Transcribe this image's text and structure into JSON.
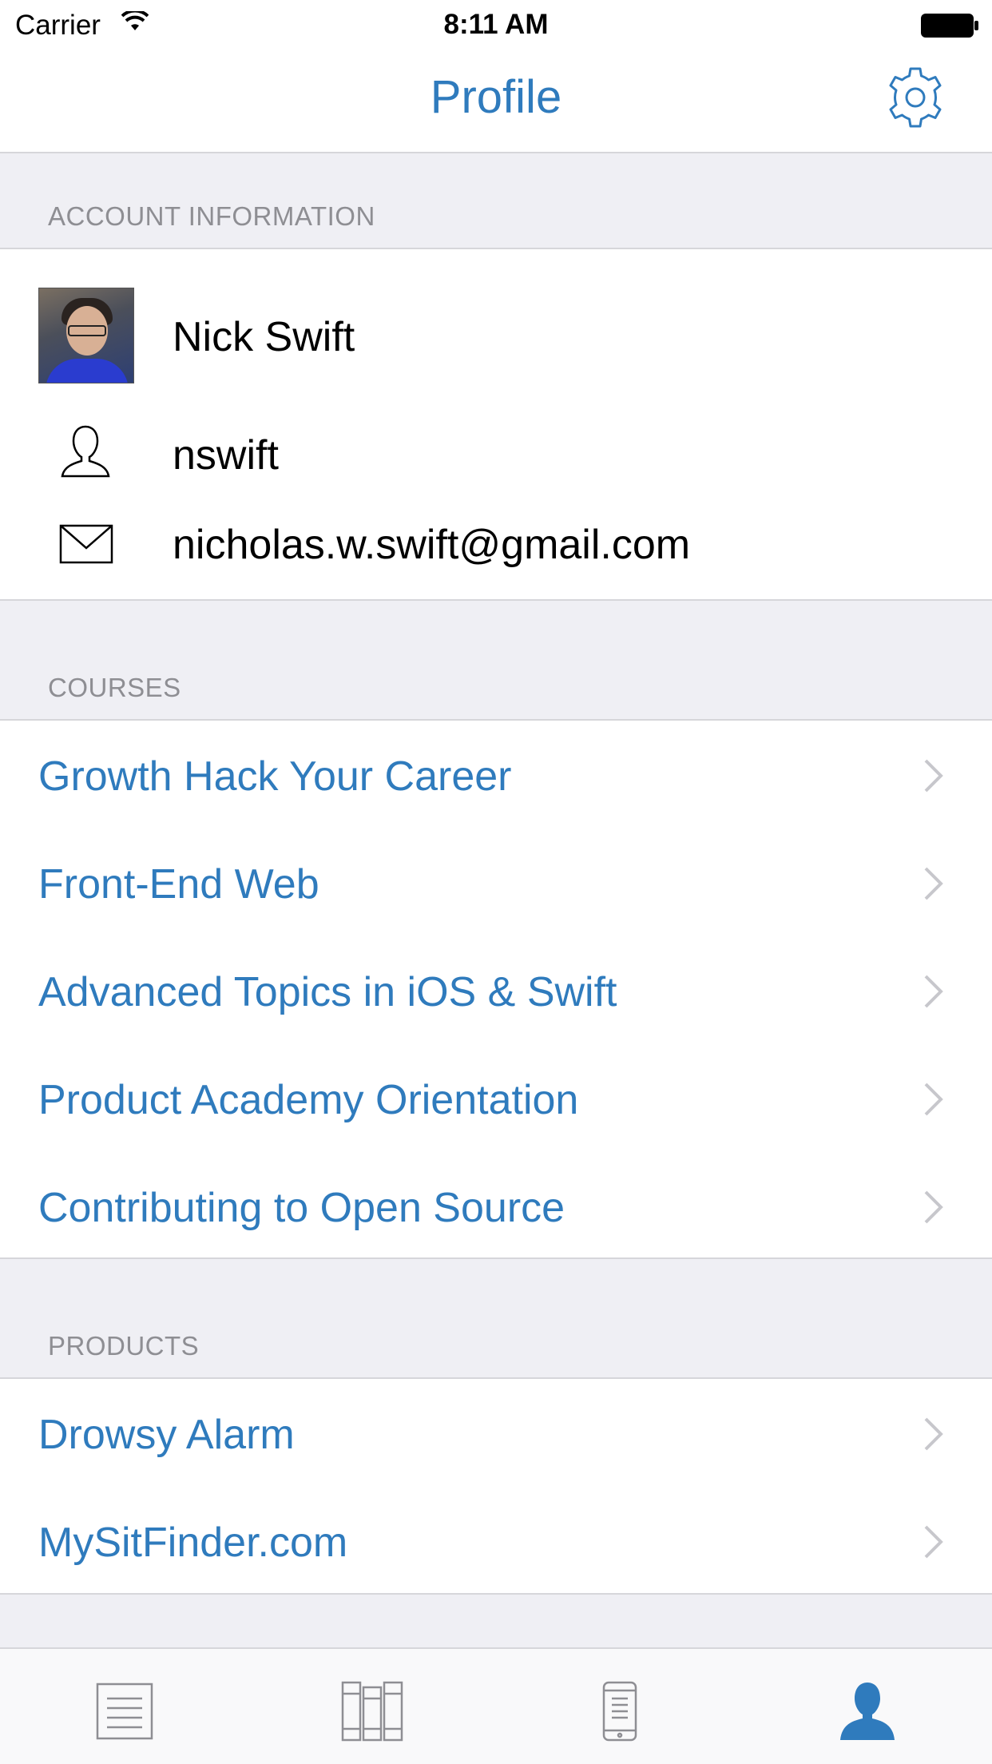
{
  "status_bar": {
    "carrier": "Carrier",
    "time": "8:11 AM"
  },
  "nav": {
    "title": "Profile",
    "settings_icon": "gear-icon"
  },
  "account": {
    "header": "ACCOUNT INFORMATION",
    "name": "Nick Swift",
    "username": "nswift",
    "email": "nicholas.w.swift@gmail.com"
  },
  "courses": {
    "header": "COURSES",
    "items": [
      {
        "label": "Growth Hack Your Career"
      },
      {
        "label": "Front-End Web"
      },
      {
        "label": "Advanced Topics in iOS & Swift"
      },
      {
        "label": "Product Academy Orientation"
      },
      {
        "label": "Contributing to Open Source"
      }
    ]
  },
  "products": {
    "header": "PRODUCTS",
    "items": [
      {
        "label": "Drowsy Alarm"
      },
      {
        "label": "MySitFinder.com"
      }
    ]
  },
  "tabs": [
    {
      "icon": "list-icon",
      "selected": false
    },
    {
      "icon": "books-icon",
      "selected": false
    },
    {
      "icon": "phone-icon",
      "selected": false
    },
    {
      "icon": "person-icon",
      "selected": true
    }
  ],
  "colors": {
    "accent": "#2f7bbd",
    "tab_inactive": "#8e8e93",
    "background": "#efeff4"
  }
}
